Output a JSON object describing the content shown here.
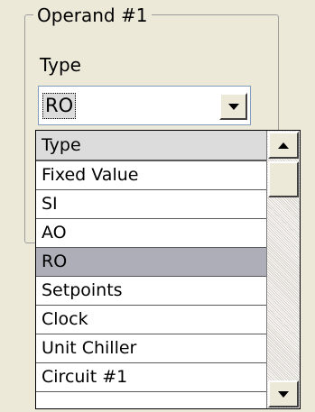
{
  "groupbox": {
    "title": "Operand #1"
  },
  "type_field": {
    "label": "Type",
    "value": "RO"
  },
  "dropdown": {
    "header": "Type",
    "items": [
      {
        "label": "Fixed Value",
        "selected": false
      },
      {
        "label": "SI",
        "selected": false
      },
      {
        "label": "AO",
        "selected": false
      },
      {
        "label": "RO",
        "selected": true
      },
      {
        "label": "Setpoints",
        "selected": false
      },
      {
        "label": "Clock",
        "selected": false
      },
      {
        "label": "Unit Chiller",
        "selected": false
      },
      {
        "label": "Circuit #1",
        "selected": false
      }
    ]
  },
  "icons": {
    "combo_button": "chevron-down-icon",
    "scroll_up": "arrow-up-icon",
    "scroll_down": "arrow-down-icon"
  },
  "colors": {
    "background": "#ece9d8",
    "selected_row": "#aeaeb8",
    "header_row": "#dcdcdc",
    "combo_border": "#7f9db9"
  }
}
